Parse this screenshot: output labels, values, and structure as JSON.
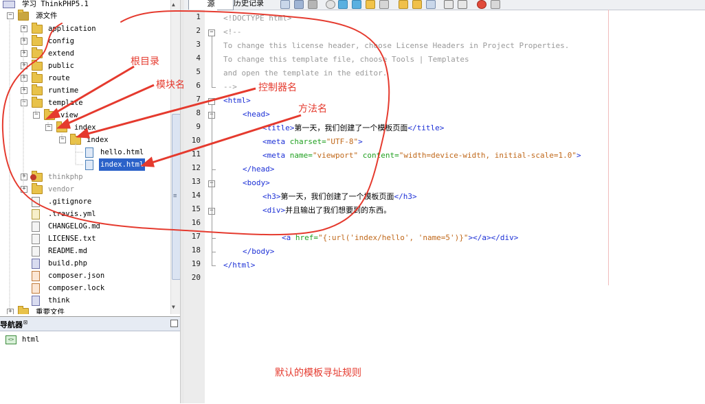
{
  "project_tree": {
    "root_label": "学习 ThinkPHP5.1",
    "source_folder": "源文件",
    "items": [
      {
        "label": "application"
      },
      {
        "label": "config"
      },
      {
        "label": "extend"
      },
      {
        "label": "public"
      },
      {
        "label": "route"
      },
      {
        "label": "runtime"
      },
      {
        "label": "template"
      },
      {
        "label": "view"
      },
      {
        "label": "index"
      },
      {
        "label": "index"
      },
      {
        "label": "hello.html"
      },
      {
        "label": "index.html"
      },
      {
        "label": "thinkphp"
      },
      {
        "label": "vendor"
      },
      {
        "label": ".gitignore"
      },
      {
        "label": ".travis.yml"
      },
      {
        "label": "CHANGELOG.md"
      },
      {
        "label": "LICENSE.txt"
      },
      {
        "label": "README.md"
      },
      {
        "label": "build.php"
      },
      {
        "label": "composer.json"
      },
      {
        "label": "composer.lock"
      },
      {
        "label": "think"
      }
    ],
    "important_files": "重要文件"
  },
  "navigator": {
    "title": "导航器",
    "close_glyph": "⊠",
    "item": "html"
  },
  "editor": {
    "tabs": {
      "source": "源",
      "history": "历史记录"
    },
    "line_numbers": [
      "1",
      "2",
      "3",
      "4",
      "5",
      "6",
      "7",
      "8",
      "9",
      "10",
      "11",
      "12",
      "13",
      "14",
      "15",
      "16",
      "17",
      "18",
      "19",
      "20"
    ],
    "code": {
      "l1": "<!DOCTYPE html>",
      "l2": "<!--",
      "l3": "To change this license header, choose License Headers in Project Properties.",
      "l4": "To change this template file, choose Tools | Templates",
      "l5": "and open the template in the editor.",
      "l6": "-->",
      "l7": "<html>",
      "l8": "<head>",
      "l9_open": "<title>",
      "l9_text": "第一天，我们创建了一个模板页面",
      "l9_close": "</title>",
      "l10_tag": "<meta ",
      "l10_attr": "charset=",
      "l10_val": "\"UTF-8\"",
      "l10_end": ">",
      "l11_tag": "<meta ",
      "l11_attr1": "name=",
      "l11_val1": "\"viewport\"",
      "l11_attr2": " content=",
      "l11_val2": "\"width=device-width, initial-scale=1.0\"",
      "l11_end": ">",
      "l12": "</head>",
      "l13": "<body>",
      "l14_open": "<h3>",
      "l14_text": "第一天，我们创建了一个模板页面",
      "l14_close": "</h3>",
      "l15_open": "<div>",
      "l15_text": "并且输出了我们想要到的东西。",
      "l17_tag": "<a ",
      "l17_attr": "href=",
      "l17_val": "\"{:url('index/hello', 'name=5')}\"",
      "l17_end": "></a></div>",
      "l18": "</body>",
      "l19": "</html>"
    }
  },
  "annotations": {
    "root_dir": "根目录",
    "module_name": "模块名",
    "controller_name": "控制器名",
    "method_name": "方法名",
    "caption": "默认的模板寻址规则"
  },
  "colors": {
    "annotation": "#e53a2e",
    "tag": "#1b2fd6",
    "attr": "#20a020",
    "value": "#c0681a",
    "comment": "#9a9a9a",
    "selection": "#2b62c9"
  }
}
